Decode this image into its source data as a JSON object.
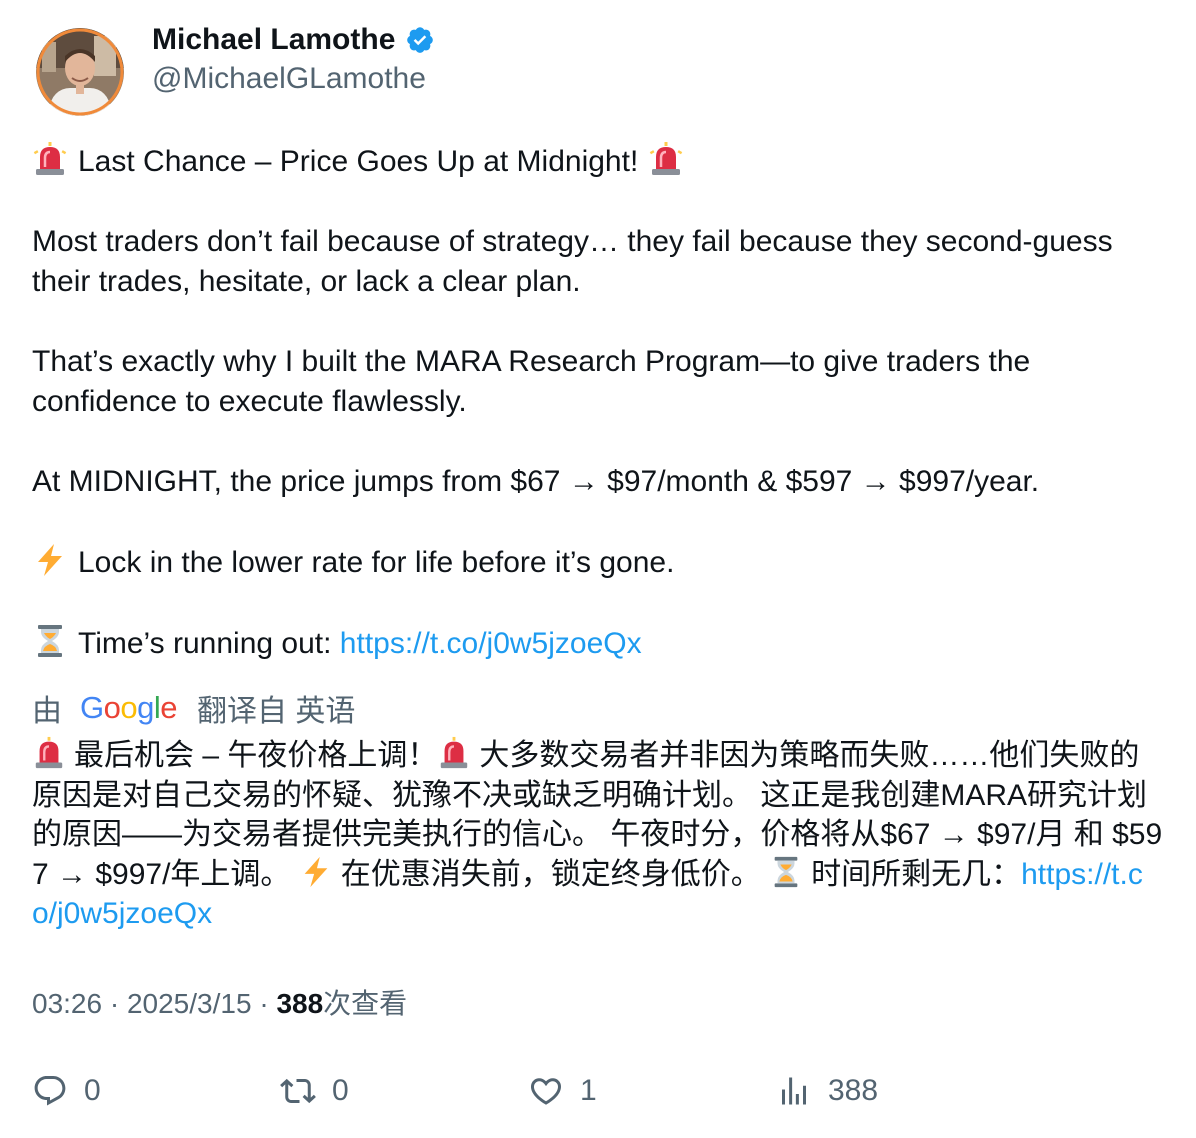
{
  "author": {
    "display_name": "Michael Lamothe",
    "handle": "@MichaelGLamothe",
    "verified_icon": "verified-badge-icon",
    "avatar": "profile-photo"
  },
  "tweet": {
    "headline": "Last Chance – Price Goes Up at Midnight!",
    "para1": "Most traders don’t fail because of strategy… they fail because they second-guess their trades, hesitate, or lack a clear plan.",
    "para2": "That’s exactly why I built the MARA Research Program—to give traders the confidence to execute flawlessly.",
    "para3": "At MIDNIGHT, the price jumps from $67 → $97/month & $597 → $997/year.",
    "para4": "Lock in the lower rate for life before it’s gone.",
    "para5_text": "Time’s running out: ",
    "link": "https://t.co/j0w5jzoeQx",
    "emojis": [
      "rotating-light-icon",
      "zap-icon",
      "hourglass-icon"
    ]
  },
  "translation": {
    "prefix": "由",
    "provider": "Google",
    "suffix": "翻译自 英语",
    "text_part1": "最后机会 – 午夜价格上调！",
    "text_part2": "大多数交易者并非因为策略而失败……他们失败的原因是对自己交易的怀疑、犹豫不决或缺乏明确计划。 这正是我创建MARA研究计划的原因——为交易者提供完美执行的信心。 午夜时分，价格将从$67 → $97/月 和 $597 → $997/年上调。",
    "text_part3": "在优惠消失前，锁定终身低价。",
    "text_part4": "时间所剩无几：",
    "link": "https://t.co/j0w5jzoeQx"
  },
  "meta": {
    "time": "03:26",
    "separator": "·",
    "date": "2025/3/15",
    "views_count": "388",
    "views_label": "次查看"
  },
  "actions": {
    "reply_count": "0",
    "retweet_count": "0",
    "like_count": "1",
    "view_count": "388"
  },
  "colors": {
    "link": "#1d9bf0",
    "secondary_text": "#536471",
    "primary_text": "#0f1419",
    "verified": "#1d9bf0"
  }
}
